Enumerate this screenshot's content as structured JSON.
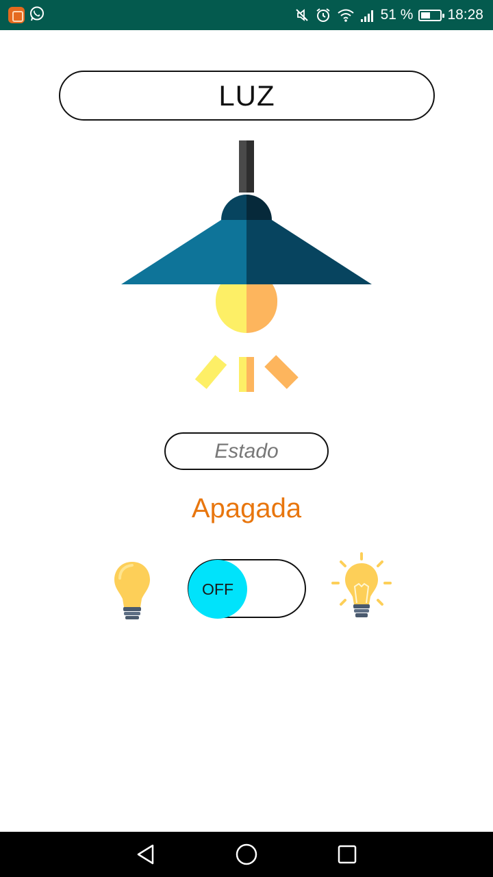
{
  "status_bar": {
    "battery_percent_text": "51 %",
    "battery_level": 0.51,
    "time": "18:28",
    "icons": [
      "app-notification-icon",
      "whatsapp-icon",
      "mute-icon",
      "alarm-icon",
      "wifi-icon",
      "signal-icon",
      "battery-icon"
    ]
  },
  "header": {
    "title": "LUZ"
  },
  "state": {
    "label": "Estado",
    "value": "Apagada"
  },
  "toggle": {
    "label": "OFF",
    "checked": false
  },
  "colors": {
    "status_bar": "#045a4e",
    "accent_orange": "#e8760e",
    "toggle_knob": "#00e3fb",
    "lamp_shade_light": "#0e7499",
    "lamp_shade_dark": "#07445f",
    "bulb_yellow": "#fdef66",
    "bulb_orange": "#fdb55d"
  },
  "nav_bar": {
    "buttons": [
      "back-icon",
      "home-icon",
      "recents-icon"
    ]
  }
}
